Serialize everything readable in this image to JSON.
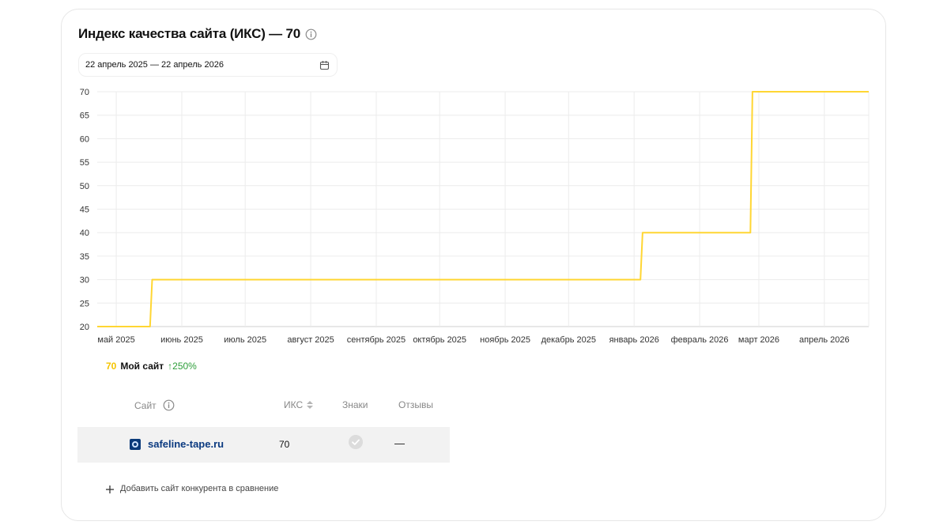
{
  "header": {
    "title": "Индекс качества сайта (ИКС) — 70",
    "info_icon": "info-circle-icon"
  },
  "date_range": {
    "value": "22 апрель 2025 — 22 апрель 2026",
    "icon": "calendar-icon"
  },
  "chart_data": {
    "type": "line",
    "step": true,
    "x_ticks": [
      "май 2025",
      "июнь 2025",
      "июль 2025",
      "август 2025",
      "сентябрь 2025",
      "октябрь 2025",
      "ноябрь 2025",
      "декабрь 2025",
      "январь 2026",
      "февраль 2026",
      "март 2026",
      "апрель 2026"
    ],
    "y_ticks": [
      20,
      25,
      30,
      35,
      40,
      45,
      50,
      55,
      60,
      65,
      70
    ],
    "ylim": [
      20,
      70
    ],
    "xlim": [
      "2025-04-22",
      "2026-04-22"
    ],
    "grid": true,
    "series": [
      {
        "name": "Мой сайт",
        "color": "#ffd633",
        "points": [
          {
            "x": "2025-04-22",
            "y": 20
          },
          {
            "x": "2025-05-17",
            "y": 20
          },
          {
            "x": "2025-05-18",
            "y": 30
          },
          {
            "x": "2026-01-04",
            "y": 30
          },
          {
            "x": "2026-01-05",
            "y": 40
          },
          {
            "x": "2026-02-25",
            "y": 40
          },
          {
            "x": "2026-02-26",
            "y": 70
          },
          {
            "x": "2026-04-22",
            "y": 70
          }
        ]
      }
    ]
  },
  "legend": {
    "value": "70",
    "name": "Мой сайт",
    "change": "↑250%",
    "value_color": "#f5c400",
    "change_color": "#2e9e3a"
  },
  "table": {
    "columns": {
      "site": "Сайт",
      "iks": "ИКС",
      "signs": "Знаки",
      "reviews": "Отзывы"
    },
    "rows": [
      {
        "site": "safeline-tape.ru",
        "iks": "70",
        "signs_icon": "check-circle-icon",
        "reviews": "—"
      }
    ]
  },
  "add_competitor": {
    "label": "Добавить сайт конкурента в сравнение",
    "icon": "plus-icon"
  }
}
